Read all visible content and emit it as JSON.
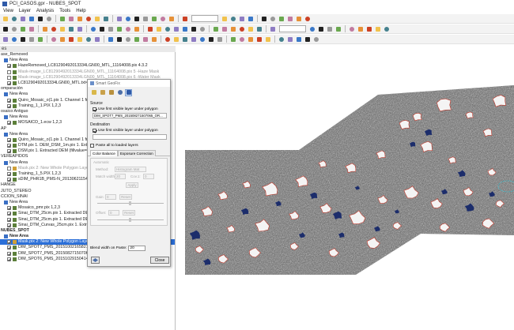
{
  "window": {
    "title": "PCI_CASOS.gpr - NUBES_SPOT"
  },
  "menu": [
    "View",
    "Layer",
    "Analysis",
    "Tools",
    "Help"
  ],
  "panel": {
    "header": "es"
  },
  "layers": [
    {
      "label": "ase_Removed",
      "check": false,
      "icon": "none",
      "style": "normal",
      "indent": 0
    },
    {
      "label": "New Area",
      "check": false,
      "icon": "folder-icon",
      "style": "normal",
      "indent": 2
    },
    {
      "label": "HazeRemoved_LC81290492013334LGN00_MTL_11164008.pix 4.3.2",
      "check": true,
      "icon": "raster-icon",
      "style": "normal",
      "indent": 4
    },
    {
      "label": "Mask-image_LC81290492013334LGN00_MTL_11164008.pix 5 -Haze Mask",
      "check": false,
      "icon": "raster-icon",
      "style": "grey",
      "indent": 4
    },
    {
      "label": "Mask-image_LC81290492013334LGN00_MTL_11164008.pix 6 -Water Mask",
      "check": false,
      "icon": "raster-icon",
      "style": "grey",
      "indent": 4
    },
    {
      "label": "LC81290492013334LGN00_MTL.txt<MS 4,3,2",
      "check": true,
      "icon": "raster-icon",
      "style": "normal",
      "indent": 4
    },
    {
      "label": "omparación",
      "check": false,
      "icon": "none",
      "style": "normal",
      "indent": 0
    },
    {
      "label": "New Area",
      "check": false,
      "icon": "folder-icon",
      "style": "normal",
      "indent": 2
    },
    {
      "label": "Quiro_Mosaic_o(1.pix 1. Channel 1 from C:\\Da",
      "check": true,
      "icon": "raster-icon",
      "style": "normal",
      "indent": 4
    },
    {
      "label": "Training_1_1.PIX 1,2,3",
      "check": true,
      "icon": "raster-icon",
      "style": "normal",
      "indent": 4
    },
    {
      "label": "osaico Antiguo",
      "check": false,
      "icon": "none",
      "style": "normal",
      "indent": 0
    },
    {
      "label": "New Area",
      "check": false,
      "icon": "folder-icon",
      "style": "normal",
      "indent": 2
    },
    {
      "label": "MOSAICO_1.ecw 1,2,3",
      "check": true,
      "icon": "raster-icon",
      "style": "normal",
      "indent": 4
    },
    {
      "label": "AP",
      "check": false,
      "icon": "none",
      "style": "normal",
      "indent": 0
    },
    {
      "label": "New Area",
      "check": false,
      "icon": "folder-icon",
      "style": "normal",
      "indent": 2
    },
    {
      "label": "Quiro_Mosaic_o(1.pix 1. Channel 1 from C:\\Da",
      "check": true,
      "icon": "raster-icon",
      "style": "normal",
      "indent": 4
    },
    {
      "label": "DTM.pix 1. DEM_DSM_1m.pix 1. Extracted DE",
      "check": true,
      "icon": "raster-icon",
      "style": "normal",
      "indent": 4
    },
    {
      "label": "DSM.pix 1. Extracted DEM (fillvalue=100 Back=",
      "check": true,
      "icon": "raster-icon",
      "style": "normal",
      "indent": 4
    },
    {
      "label": "VEREAPIDOS",
      "check": false,
      "icon": "none",
      "style": "normal",
      "indent": 0
    },
    {
      "label": "New Area",
      "check": false,
      "icon": "folder-icon",
      "style": "normal",
      "indent": 2
    },
    {
      "label": "Mask.pix 2: New Whole Polygon Layer",
      "check": false,
      "icon": "vector-icon",
      "style": "grey",
      "indent": 4
    },
    {
      "label": "Training_1_5.PIX 1,2,3",
      "check": true,
      "icon": "raster-icon",
      "style": "normal",
      "indent": 4
    },
    {
      "label": "sDIM_PHR1B_PMS-N_201306211547052_SE",
      "check": true,
      "icon": "raster-icon",
      "style": "normal",
      "indent": 4
    },
    {
      "label": "HANGE",
      "check": false,
      "icon": "none",
      "style": "normal",
      "indent": 0
    },
    {
      "label": "JUTO_STEREO",
      "check": false,
      "icon": "none",
      "style": "normal",
      "indent": 0
    },
    {
      "label": "CCION_SINAI",
      "check": false,
      "icon": "none",
      "style": "normal",
      "indent": 0
    },
    {
      "label": "New Area",
      "check": false,
      "icon": "folder-icon",
      "style": "normal",
      "indent": 2
    },
    {
      "label": "Mosaico_pmr.pix 1,2,3",
      "check": true,
      "icon": "raster-icon",
      "style": "normal",
      "indent": 4
    },
    {
      "label": "Sinai_DTM_25cm.pix 1. Extracted DEM fallede",
      "check": true,
      "icon": "raster-icon",
      "style": "normal",
      "indent": 4
    },
    {
      "label": "Sinai_DTM_25cm.pix 1. Extracted DEM fallede",
      "check": true,
      "icon": "raster-icon",
      "style": "normal",
      "indent": 4
    },
    {
      "label": "Sinai_DTM_Curvas_25cm.pix 1. Extracted DEM",
      "check": true,
      "icon": "raster-icon",
      "style": "normal",
      "indent": 4
    },
    {
      "label": "NUBES_SPOT",
      "check": false,
      "icon": "none",
      "style": "bold",
      "indent": 0
    },
    {
      "label": "New Area",
      "check": false,
      "icon": "folder-icon",
      "style": "bold",
      "indent": 2
    },
    {
      "label": "Mask.pix 2: New Whole Polygon Layer",
      "check": true,
      "icon": "vector-icon",
      "style": "selected",
      "indent": 4
    },
    {
      "label": "DIM_SPOT7_PMS_201510021658211_ORT_",
      "check": true,
      "icon": "raster-icon",
      "style": "normal",
      "indent": 4
    },
    {
      "label": "DIM_SPOT7_PMS_201508271507065_ORT_",
      "check": true,
      "icon": "raster-icon",
      "style": "normal",
      "indent": 4
    },
    {
      "label": "DIM_SPOT6_PMS_201510291504142_ORT_",
      "check": true,
      "icon": "raster-icon",
      "style": "normal",
      "indent": 4
    }
  ],
  "dialog": {
    "title": "Smart GeoFix",
    "source_label": "Source",
    "source_check": "Use first visible layer under polygon",
    "source_value": "DIM_SPOT7_PMS_201508271507065_OR...",
    "destination_label": "Destination",
    "destination_check": "Use first visible layer under polygon",
    "destination_value": "",
    "paste_all": "Paste all to loaded layers",
    "tab_color": "Color Balance",
    "tab_exposure": "Exposure Correction",
    "automatic": "Automatic",
    "method_label": "Method:",
    "method_value": "Histogram Mat",
    "match_width_label": "Match width:",
    "match_width_value": "20",
    "cov_label": "Cov.1:",
    "cov_value": "0",
    "apply_label": "Apply",
    "gain_label": "Gain:",
    "gain_value": "0",
    "offset_label": "Offset:",
    "offset_value": "0",
    "reset_label": "Reset",
    "blend_label": "Blend width on Paste:",
    "blend_value": "20",
    "close_label": "Close"
  },
  "colors": {
    "selection": "#2b6fd8",
    "cloud_outline": "#c0392b",
    "water": "#1c2d6b",
    "raster_texture": "#7b7b7b"
  }
}
